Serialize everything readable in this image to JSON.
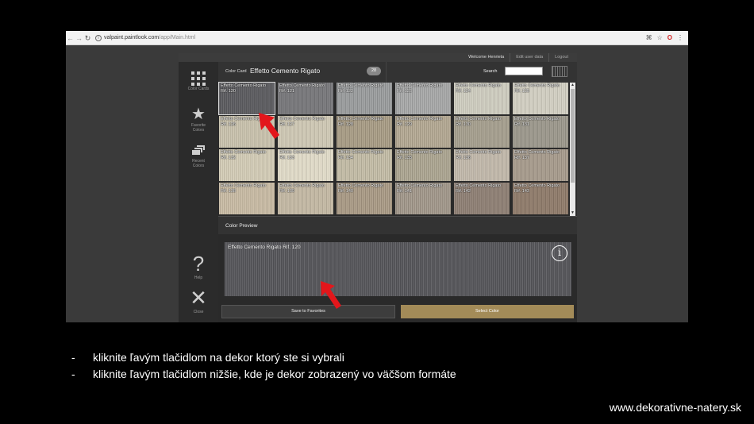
{
  "browser": {
    "url_host": "valpaint.paintlook.com",
    "url_path": "/app/Main.html"
  },
  "topbar": {
    "welcome": "Welcome Henrieta",
    "edit_user": "Edit user data",
    "logout": "Logout"
  },
  "sidebar": {
    "color_cards": "Color Cards",
    "favorite_colors_line1": "Favorite",
    "favorite_colors_line2": "Colors",
    "recent_colors_line1": "Recent",
    "recent_colors_line2": "Colors",
    "help": "Help",
    "close": "Close"
  },
  "header": {
    "color_card_label": "Color Card",
    "color_card_title": "Effetto Cemento Rigato",
    "count": "28",
    "search_label": "Search",
    "search_value": ""
  },
  "swatches": [
    {
      "label": "Effetto Cemento Rigato Rif. 120",
      "color": "#5b5b5f"
    },
    {
      "label": "Effetto Cemento Rigato Rif. 121",
      "color": "#77777a"
    },
    {
      "label": "Effetto Cemento Rigato Rif. 122",
      "color": "#9a9c9d"
    },
    {
      "label": "Effetto Cemento Rigato Rif. 123",
      "color": "#a7a8a8"
    },
    {
      "label": "Effetto Cemento Rigato Rif. 124",
      "color": "#cfcdc0"
    },
    {
      "label": "Effetto Cemento Rigato Rif. 125",
      "color": "#d2cfc2"
    },
    {
      "label": "Effetto Cemento Rigato Rif. 126",
      "color": "#c9c2ad"
    },
    {
      "label": "Effetto Cemento Rigato Rif. 127",
      "color": "#cfc8b4"
    },
    {
      "label": "Effetto Cemento Rigato Rif. 128",
      "color": "#a89c85"
    },
    {
      "label": "Effetto Cemento Rigato Rif. 129",
      "color": "#b3a892"
    },
    {
      "label": "Effetto Cemento Rigato Rif. 130",
      "color": "#a69f8e"
    },
    {
      "label": "Effetto Cemento Rigato Rif. 131",
      "color": "#9c988c"
    },
    {
      "label": "Effetto Cemento Rigato Rif. 132",
      "color": "#d3ccb6"
    },
    {
      "label": "Effetto Cemento Rigato Rif. 133",
      "color": "#e1dbc8"
    },
    {
      "label": "Effetto Cemento Rigato Rif. 134",
      "color": "#c3bca6"
    },
    {
      "label": "Effetto Cemento Rigato Rif. 135",
      "color": "#aca591"
    },
    {
      "label": "Effetto Cemento Rigato Rif. 136",
      "color": "#c2b9ab"
    },
    {
      "label": "Effetto Cemento Rigato Rif. 137",
      "color": "#a79b8c"
    },
    {
      "label": "Effetto Cemento Rigato Rif. 138",
      "color": "#c8bba4"
    },
    {
      "label": "Effetto Cemento Rigato Rif. 139",
      "color": "#c4b9a4"
    },
    {
      "label": "Effetto Cemento Rigato Rif. 140",
      "color": "#a99a85"
    },
    {
      "label": "Effetto Cemento Rigato Rif. 141",
      "color": "#a1978a"
    },
    {
      "label": "Effetto Cemento Rigato Rif. 142",
      "color": "#8e7f74"
    },
    {
      "label": "Effetto Cemento Rigato Rif. 143",
      "color": "#8f7b6a"
    }
  ],
  "preview": {
    "section_title": "Color Preview",
    "label": "Effetto Cemento Rigato Rif. 120",
    "info_glyph": "i"
  },
  "buttons": {
    "save_to_favorites": "Save to Favorites",
    "select_color": "Select Color"
  },
  "instructions": [
    "kliknite ľavým tlačidlom na dekor ktorý ste si vybrali",
    "kliknite ľavým tlačidlom nižšie, kde je dekor zobrazený vo väčšom formáte"
  ],
  "website": "www.dekorativne-natery.sk",
  "colors": {
    "accent_gold": "#a38b58",
    "arrow_red": "#e3161b"
  }
}
